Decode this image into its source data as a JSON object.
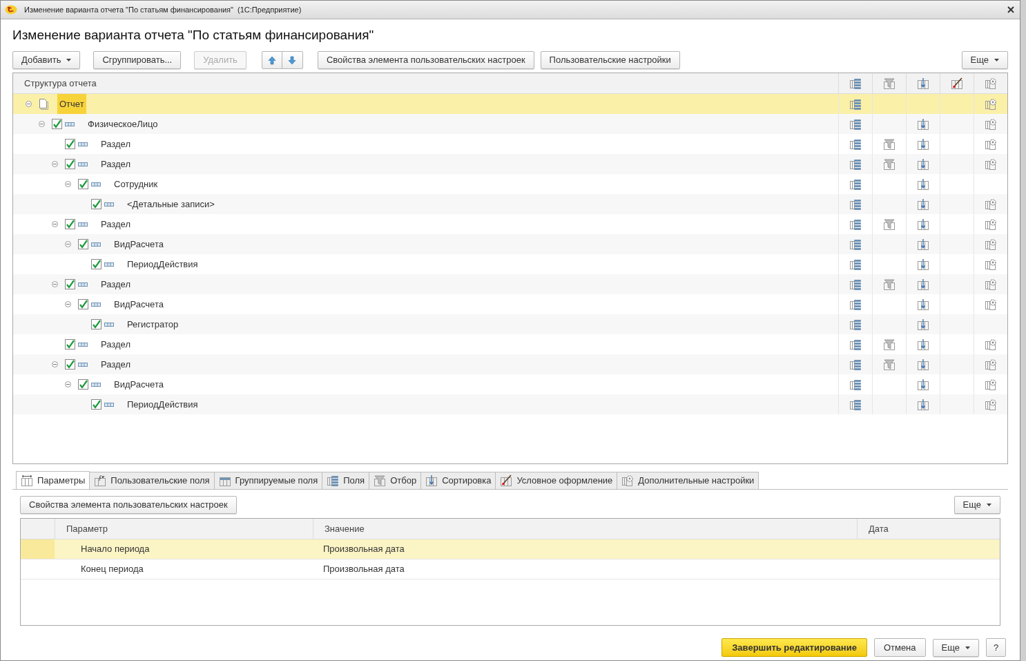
{
  "window": {
    "title": "Изменение варианта отчета \"По статьям финансирования\"  (1С:Предприятие)"
  },
  "form_title": "Изменение варианта отчета \"По статьям финансирования\"",
  "toolbar": {
    "buttons": [
      {
        "label": "Добавить",
        "dropdown": true,
        "disabled": false
      },
      {
        "label": "Сгруппировать...",
        "dropdown": false,
        "disabled": false
      },
      {
        "label": "Удалить",
        "dropdown": false,
        "disabled": true
      }
    ],
    "buttons_after_arrows": [
      {
        "label": "Свойства элемента пользовательских настроек",
        "dropdown": false,
        "disabled": false
      },
      {
        "label": "Пользовательские настройки",
        "dropdown": false,
        "disabled": false
      }
    ],
    "more": "Еще"
  },
  "tree": {
    "header": "Структура отчета",
    "rows": [
      {
        "kind": "report",
        "label": "Отчет",
        "selected": true,
        "expanded": true,
        "fields": true,
        "filter": false,
        "order": false,
        "appearance": false,
        "settings": true,
        "children": [
          {
            "kind": "group",
            "label": "ФизическоеЛицо",
            "checked": true,
            "selected": false,
            "expanded": true,
            "fields": true,
            "filter": false,
            "order": true,
            "appearance": false,
            "settings": true,
            "children": [
              {
                "kind": "group",
                "label": "Раздел",
                "checked": true,
                "selected": false,
                "fields": true,
                "filter": true,
                "order": true,
                "appearance": false,
                "settings": true
              },
              {
                "kind": "group",
                "label": "Раздел",
                "checked": true,
                "selected": false,
                "expanded": true,
                "fields": true,
                "filter": true,
                "order": true,
                "appearance": false,
                "settings": true,
                "children": [
                  {
                    "kind": "group",
                    "label": "Сотрудник",
                    "checked": true,
                    "selected": false,
                    "expanded": true,
                    "fields": true,
                    "filter": false,
                    "order": true,
                    "appearance": false,
                    "settings": false,
                    "children": [
                      {
                        "kind": "group",
                        "label": "<Детальные записи>",
                        "checked": true,
                        "selected": false,
                        "fields": true,
                        "filter": false,
                        "order": true,
                        "appearance": false,
                        "settings": true
                      }
                    ]
                  }
                ]
              },
              {
                "kind": "group",
                "label": "Раздел",
                "checked": true,
                "selected": false,
                "expanded": true,
                "fields": true,
                "filter": true,
                "order": true,
                "appearance": false,
                "settings": true,
                "children": [
                  {
                    "kind": "group",
                    "label": "ВидРасчета",
                    "checked": true,
                    "selected": false,
                    "expanded": true,
                    "fields": true,
                    "filter": false,
                    "order": true,
                    "appearance": false,
                    "settings": true,
                    "children": [
                      {
                        "kind": "group",
                        "label": "ПериодДействия",
                        "checked": true,
                        "selected": false,
                        "fields": true,
                        "filter": false,
                        "order": true,
                        "appearance": false,
                        "settings": true
                      }
                    ]
                  }
                ]
              },
              {
                "kind": "group",
                "label": "Раздел",
                "checked": true,
                "selected": false,
                "expanded": true,
                "fields": true,
                "filter": true,
                "order": true,
                "appearance": false,
                "settings": true,
                "children": [
                  {
                    "kind": "group",
                    "label": "ВидРасчета",
                    "checked": true,
                    "selected": false,
                    "expanded": true,
                    "fields": true,
                    "filter": false,
                    "order": true,
                    "appearance": false,
                    "settings": true,
                    "children": [
                      {
                        "kind": "group",
                        "label": "Регистратор",
                        "checked": true,
                        "selected": false,
                        "fields": true,
                        "filter": false,
                        "order": true,
                        "appearance": false,
                        "settings": false
                      }
                    ]
                  }
                ]
              },
              {
                "kind": "group",
                "label": "Раздел",
                "checked": true,
                "selected": false,
                "fields": true,
                "filter": true,
                "order": true,
                "appearance": false,
                "settings": true
              },
              {
                "kind": "group",
                "label": "Раздел",
                "checked": true,
                "selected": false,
                "expanded": true,
                "fields": true,
                "filter": true,
                "order": true,
                "appearance": false,
                "settings": true,
                "children": [
                  {
                    "kind": "group",
                    "label": "ВидРасчета",
                    "checked": true,
                    "selected": false,
                    "expanded": true,
                    "fields": true,
                    "filter": false,
                    "order": true,
                    "appearance": false,
                    "settings": true,
                    "children": [
                      {
                        "kind": "group",
                        "label": "ПериодДействия",
                        "checked": true,
                        "selected": false,
                        "fields": true,
                        "filter": false,
                        "order": true,
                        "appearance": false,
                        "settings": true
                      }
                    ]
                  }
                ]
              }
            ]
          }
        ]
      }
    ]
  },
  "tabs": [
    {
      "kind": "parameters",
      "label": "Параметры",
      "selected": true
    },
    {
      "kind": "custom_fields",
      "label": "Пользовательские поля",
      "selected": false
    },
    {
      "kind": "group_fields",
      "label": "Группируемые поля",
      "selected": false
    },
    {
      "kind": "fields",
      "label": "Поля",
      "selected": false
    },
    {
      "kind": "filter",
      "label": "Отбор",
      "selected": false
    },
    {
      "kind": "order",
      "label": "Сортировка",
      "selected": false
    },
    {
      "kind": "appearance",
      "label": "Условное оформление",
      "selected": false
    },
    {
      "kind": "settings",
      "label": "Дополнительные настройки",
      "selected": false
    }
  ],
  "parameters_panel": {
    "button": "Свойства элемента пользовательских настроек",
    "more": "Еще",
    "columns": [
      "Параметр",
      "Значение",
      "Дата"
    ],
    "rows": [
      {
        "name": "Начало периода",
        "value": "Произвольная дата",
        "selected": true
      },
      {
        "name": "Конец периода",
        "value": "Произвольная дата",
        "selected": false
      }
    ]
  },
  "footer": {
    "primary": "Завершить редактирование",
    "cancel": "Отмена",
    "more": "Еще",
    "help": "?"
  }
}
